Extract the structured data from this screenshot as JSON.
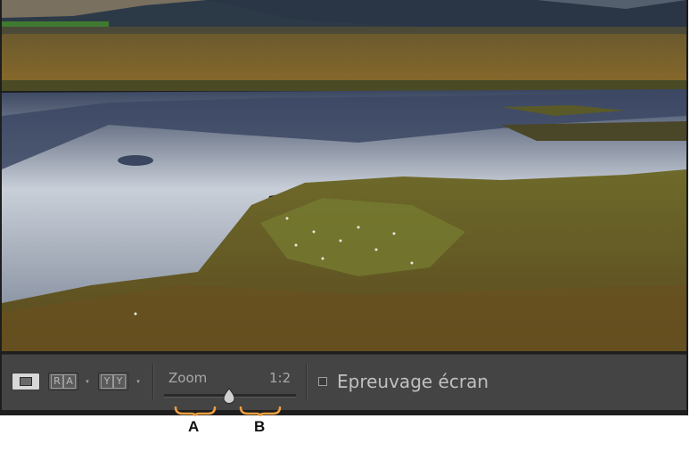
{
  "toolbar": {
    "view_buttons": [
      {
        "name": "loupe",
        "icon": "single-view-icon",
        "active": true
      },
      {
        "name": "before-after-lr",
        "glyphs": [
          "R",
          "A"
        ],
        "icon": "before-after-left-right-icon"
      },
      {
        "name": "before-after-tb",
        "glyphs": [
          "Y",
          "Y"
        ],
        "icon": "before-after-top-bottom-icon"
      }
    ],
    "dropdown_glyph": "▾",
    "zoom": {
      "label": "Zoom",
      "value_label": "1:2",
      "position": 0.49
    },
    "soft_proof": {
      "label": "Epreuvage écran",
      "checked": false
    }
  },
  "annotations": {
    "a_label": "A",
    "b_label": "B",
    "color": "#f0a040"
  },
  "photo": {
    "description_icon": "landscape-photo"
  }
}
